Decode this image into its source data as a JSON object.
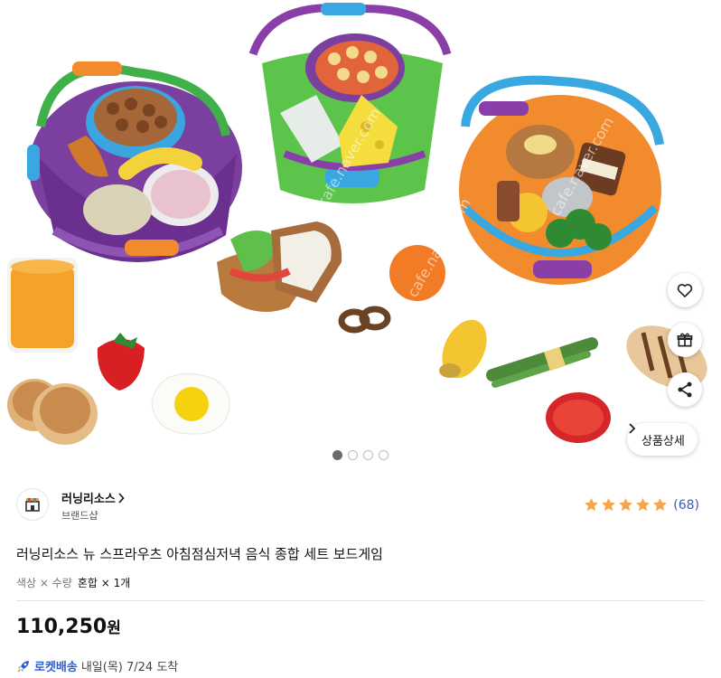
{
  "gallery": {
    "image_alt": "Learning Resources breakfast lunch dinner food play set",
    "watermark": "cafe.naver.com",
    "slide_count": 4,
    "active_slide": 1,
    "detail_button_label": "상품상세",
    "actions": [
      {
        "icon": "heart-icon",
        "name": "wishlist-button"
      },
      {
        "icon": "gift-icon",
        "name": "gift-button"
      },
      {
        "icon": "share-icon",
        "name": "share-button"
      }
    ]
  },
  "store": {
    "name": "러닝리소스",
    "type": "브랜드샵"
  },
  "rating": {
    "stars": 5,
    "count": "(68)"
  },
  "product": {
    "title": "러닝리소스 뉴 스프라우츠 아침점심저녁 음식 종합 세트 보드게임",
    "option_label": "색상 × 수량",
    "option_value": "혼합 × 1개",
    "price": "110,250",
    "currency": "원"
  },
  "delivery": {
    "label": "로켓배송",
    "date": "내일(목) 7/24 도착"
  },
  "colors": {
    "star": "#f5a64a",
    "rocket_blue": "#2a5fd6",
    "rating_count": "#3b5bb5"
  }
}
